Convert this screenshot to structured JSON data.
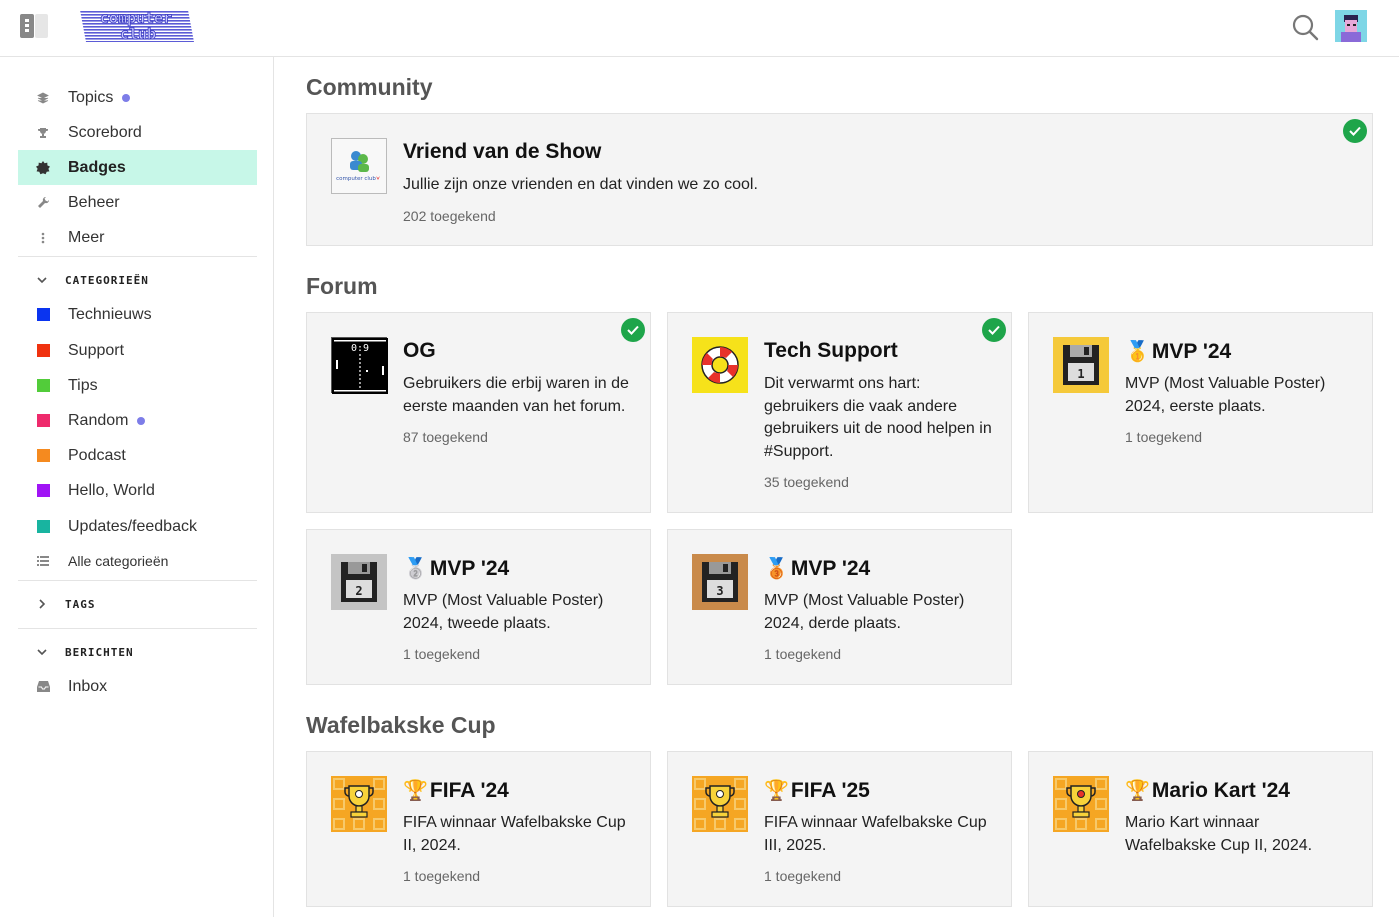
{
  "header": {
    "logo_text": "computer club"
  },
  "sidebar": {
    "nav": [
      {
        "label": "Topics",
        "icon": "layers-icon",
        "dot": true
      },
      {
        "label": "Scorebord",
        "icon": "trophy-icon"
      },
      {
        "label": "Badges",
        "icon": "badge-icon",
        "active": true
      },
      {
        "label": "Beheer",
        "icon": "wrench-icon"
      },
      {
        "label": "Meer",
        "icon": "more-vertical-icon"
      }
    ],
    "categories_header": "CATEGORIEËN",
    "categories": [
      {
        "label": "Technieuws",
        "color": "#0a34f0"
      },
      {
        "label": "Support",
        "color": "#f0320f"
      },
      {
        "label": "Tips",
        "color": "#52cc3a"
      },
      {
        "label": "Random",
        "color": "#ee2a6c",
        "dot": true
      },
      {
        "label": "Podcast",
        "color": "#f58a1f"
      },
      {
        "label": "Hello, World",
        "color": "#a014f5"
      },
      {
        "label": "Updates/feedback",
        "color": "#18b4a0"
      }
    ],
    "all_categories": "Alle categorieën",
    "tags_header": "TAGS",
    "messages_header": "BERICHTEN",
    "inbox": "Inbox"
  },
  "groups": [
    {
      "title": "Community",
      "badges": [
        {
          "title": "Vriend van de Show",
          "desc": "Jullie zijn onze vrienden en dat vinden we zo cool.",
          "count": "202 toegekend",
          "granted": true
        }
      ]
    },
    {
      "title": "Forum",
      "badges": [
        {
          "title": "OG",
          "desc": "Gebruikers die erbij waren in de eerste maanden van het forum.",
          "count": "87 toegekend",
          "granted": true
        },
        {
          "title": "Tech Support",
          "desc": "Dit verwarmt ons hart: gebruikers die vaak andere gebruikers uit de nood helpen in #Support.",
          "count": "35 toegekend",
          "granted": true
        },
        {
          "title": "MVP '24",
          "emoji": "🥇",
          "desc": "MVP (Most Valuable Poster) 2024, eerste plaats.",
          "count": "1 toegekend"
        },
        {
          "title": "MVP '24",
          "emoji": "🥈",
          "desc": "MVP (Most Valuable Poster) 2024, tweede plaats.",
          "count": "1 toegekend"
        },
        {
          "title": "MVP '24",
          "emoji": "🥉",
          "desc": "MVP (Most Valuable Poster) 2024, derde plaats.",
          "count": "1 toegekend"
        }
      ]
    },
    {
      "title": "Wafelbakske Cup",
      "badges": [
        {
          "title": "FIFA '24",
          "emoji": "🏆",
          "desc": "FIFA winnaar Wafelbakske Cup II, 2024.",
          "count": "1 toegekend"
        },
        {
          "title": "FIFA '25",
          "emoji": "🏆",
          "desc": "FIFA winnaar Wafelbakske Cup III, 2025.",
          "count": "1 toegekend"
        },
        {
          "title": "Mario Kart '24",
          "emoji": "🏆",
          "desc": "Mario Kart winnaar Wafelbakske Cup II, 2024.",
          "count": ""
        }
      ]
    }
  ],
  "og_image_text": "0:9",
  "floppy_numbers": [
    "1",
    "2",
    "3"
  ]
}
